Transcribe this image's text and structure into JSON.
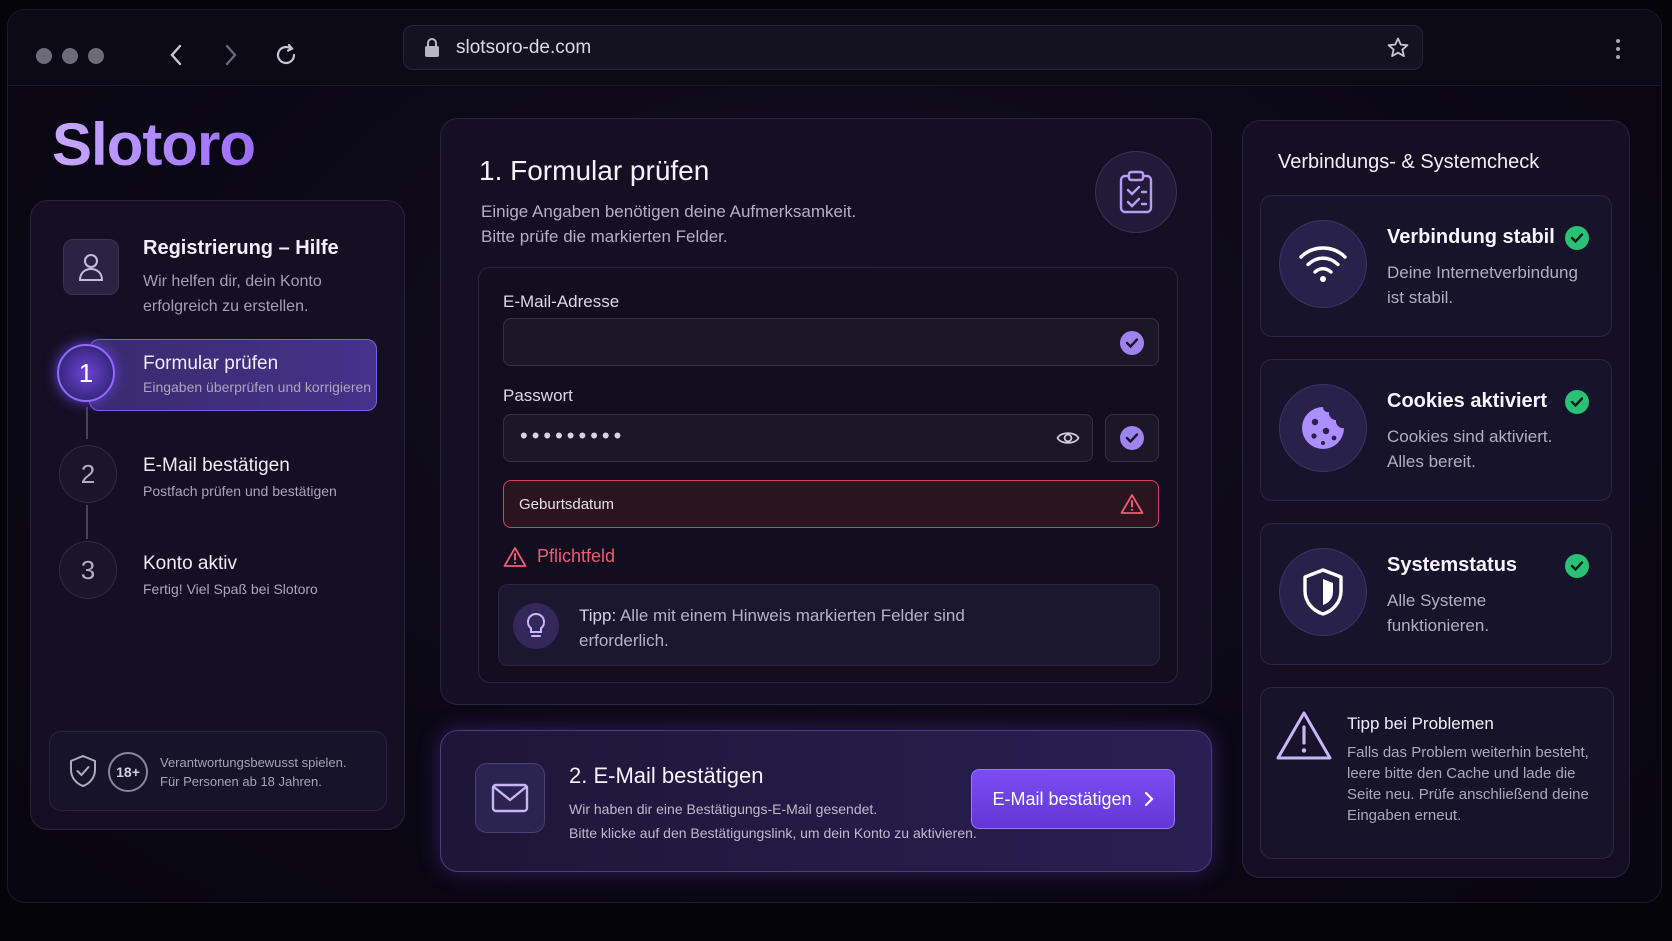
{
  "browser": {
    "url": "slotsoro-de.com"
  },
  "logo": "Slotoro",
  "sidebar": {
    "help_title": "Registrierung – Hilfe",
    "help_desc": "Wir helfen dir, dein Konto erfolgreich zu erstellen.",
    "steps": [
      {
        "num": "1",
        "title": "Formular prüfen",
        "sub": "Eingaben überprüfen und korrigieren"
      },
      {
        "num": "2",
        "title": "E-Mail bestätigen",
        "sub": "Postfach prüfen und bestätigen"
      },
      {
        "num": "3",
        "title": "Konto aktiv",
        "sub": "Fertig! Viel Spaß bei Slotoro"
      }
    ],
    "age_badge": "18+",
    "responsible_line1": "Verantwortungsbewusst spielen.",
    "responsible_line2": "Für Personen ab 18 Jahren."
  },
  "form": {
    "title": "1. Formular prüfen",
    "desc_line1": "Einige Angaben benötigen deine Aufmerksamkeit.",
    "desc_line2": "Bitte prüfe die markierten Felder.",
    "email_label": "E-Mail-Adresse",
    "password_label": "Passwort",
    "password_value": "•••••••••",
    "birthdate_placeholder": "Geburtsdatum",
    "required_text": "Pflichtfeld",
    "tip_prefix": "Tipp:",
    "tip_text": "Alle mit einem Hinweis markierten Felder sind erforderlich."
  },
  "email_step": {
    "title": "2. E-Mail bestätigen",
    "desc_line1": "Wir haben dir eine Bestätigungs-E-Mail gesendet.",
    "desc_line2": "Bitte klicke auf den Bestätigungslink, um dein Konto zu aktivieren.",
    "button": "E-Mail bestätigen"
  },
  "system_check": {
    "title": "Verbindungs- & Systemcheck",
    "cards": [
      {
        "icon": "wifi-icon",
        "title": "Verbindung stabil",
        "desc": "Deine Internetverbindung ist stabil."
      },
      {
        "icon": "cookie-icon",
        "title": "Cookies aktiviert",
        "desc": "Cookies sind aktiviert. Alles bereit."
      },
      {
        "icon": "shield-icon",
        "title": "Systemstatus",
        "desc": "Alle Systeme funktionieren."
      }
    ],
    "tip_title": "Tipp bei Problemen",
    "tip_desc": "Falls das Problem weiterhin besteht, leere bitte den Cache und lade die Seite neu. Prüfe anschließend deine Eingaben erneut."
  },
  "colors": {
    "accent": "#7b4df1",
    "error": "#f05c74",
    "success": "#29c275"
  }
}
